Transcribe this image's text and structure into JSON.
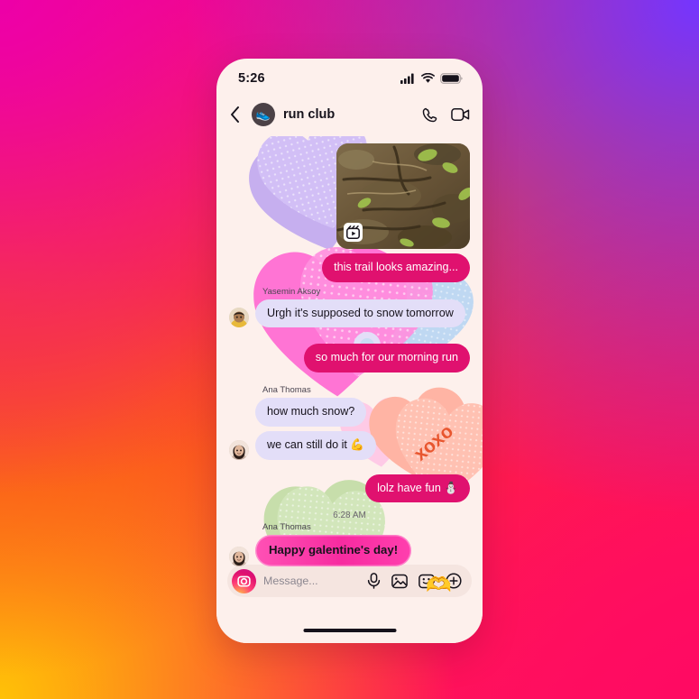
{
  "background": {
    "colors": [
      "#ED00A8",
      "#7435FF",
      "#FA4A20",
      "#FFC107",
      "#FF0A62"
    ]
  },
  "phone": {
    "status_bar": {
      "time": "5:26",
      "icons": [
        "cellular-signal-icon",
        "wifi-icon",
        "battery-icon"
      ]
    },
    "header": {
      "back_label": "‹",
      "avatar_emoji": "👟",
      "title": "run club",
      "actions": [
        {
          "name": "audio-call-icon",
          "label": "Audio call"
        },
        {
          "name": "video-call-icon",
          "label": "Video call"
        }
      ]
    },
    "thread": {
      "messages": [
        {
          "id": "m1",
          "type": "media",
          "direction": "out",
          "media_kind": "reel-video-thumbnail",
          "alt": "forest trail with twigs and green leaves"
        },
        {
          "id": "m2",
          "type": "text",
          "direction": "out",
          "text": "this trail looks amazing..."
        },
        {
          "id": "m3",
          "type": "text",
          "direction": "in",
          "sender": "Yasemin Aksoy",
          "text": "Urgh it's supposed to snow tomorrow"
        },
        {
          "id": "m4",
          "type": "text",
          "direction": "out",
          "text": "so much for our morning run"
        },
        {
          "id": "m5",
          "type": "text",
          "direction": "in",
          "sender": "Ana Thomas",
          "text": "how much snow?"
        },
        {
          "id": "m6",
          "type": "text",
          "direction": "in",
          "text": "we can still do it 💪"
        },
        {
          "id": "m7",
          "type": "text",
          "direction": "out",
          "text": "lolz have fun ⛄"
        },
        {
          "id": "m8",
          "type": "timestamp",
          "text": "6:28 AM"
        },
        {
          "id": "m9",
          "type": "text",
          "direction": "in",
          "sender": "Ana Thomas",
          "text": "Happy galentine's day!",
          "style": "highlight"
        }
      ],
      "reaction": "🫶",
      "decorations": {
        "candy_heart_text": "xoxo",
        "colors": {
          "lavender": "#C9B4F0",
          "pink": "#FF8ED6",
          "magenta_pink": "#FF6FD0",
          "blue": "#BBD6F2",
          "peach": "#FFB9A8",
          "green": "#C2DDA2"
        }
      }
    },
    "composer": {
      "camera_label": "Camera",
      "placeholder": "Message...",
      "actions": [
        {
          "name": "microphone-icon",
          "label": "Voice message"
        },
        {
          "name": "photo-icon",
          "label": "Gallery"
        },
        {
          "name": "sticker-icon",
          "label": "Stickers"
        },
        {
          "name": "plus-icon",
          "label": "More"
        }
      ]
    }
  },
  "theme": {
    "bubble_out": "#E0116F",
    "bubble_in": "#E3DEF8",
    "chat_bg": "#FDF0EC"
  }
}
